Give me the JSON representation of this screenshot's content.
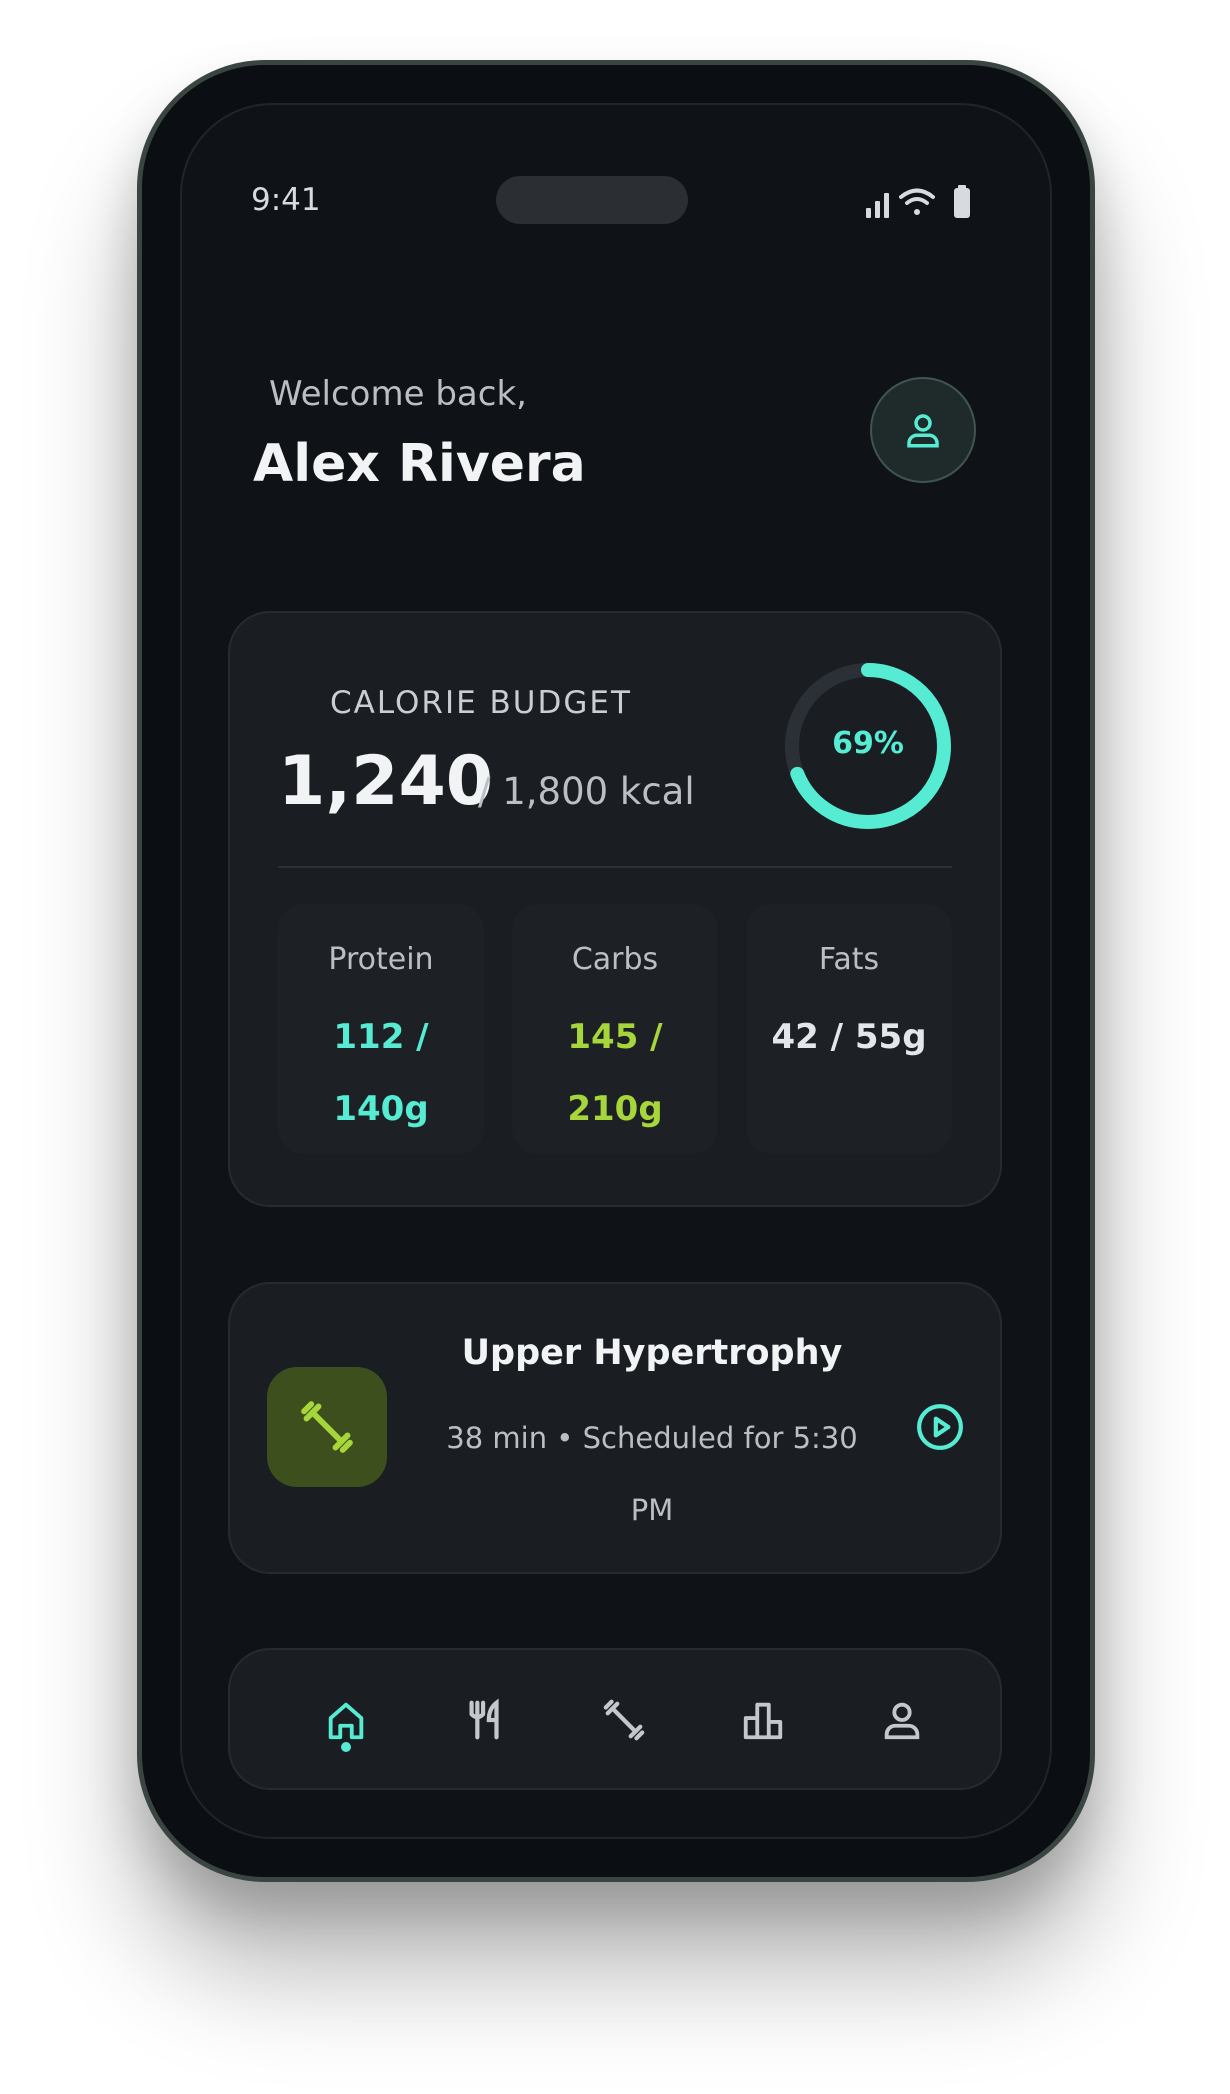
{
  "status_bar": {
    "time": "9:41",
    "icons": [
      "signal-icon",
      "wifi-icon",
      "battery-icon"
    ]
  },
  "header": {
    "greeting": "Welcome back,",
    "name": "Alex Rivera",
    "profile_icon": "user-icon"
  },
  "calorie_budget": {
    "label": "CALORIE BUDGET",
    "consumed": "1,240",
    "goal_text": "/ 1,800 kcal",
    "percent_label": "69%",
    "progress": 0.69
  },
  "macros": [
    {
      "name": "Protein",
      "value": "112 / 140g",
      "color": "#56ecd3"
    },
    {
      "name": "Carbs",
      "value": "145 / 210g",
      "color": "#a6d63a"
    },
    {
      "name": "Fats",
      "value": "42 / 55g",
      "color": "#e4e7ea"
    }
  ],
  "workout": {
    "title": "Upper Hypertrophy",
    "subtitle": "38 min • Scheduled for 5:30 PM",
    "icon": "dumbbell-icon",
    "action_icon": "play-icon"
  },
  "nav": {
    "items": [
      "home-icon",
      "utensils-icon",
      "dumbbell-icon",
      "bar-chart-icon",
      "user-icon"
    ],
    "active_index": 0
  },
  "colors": {
    "accent": "#56ecd3",
    "lime": "#a6d63a",
    "background": "#0f1216",
    "card": "#1a1e23"
  }
}
